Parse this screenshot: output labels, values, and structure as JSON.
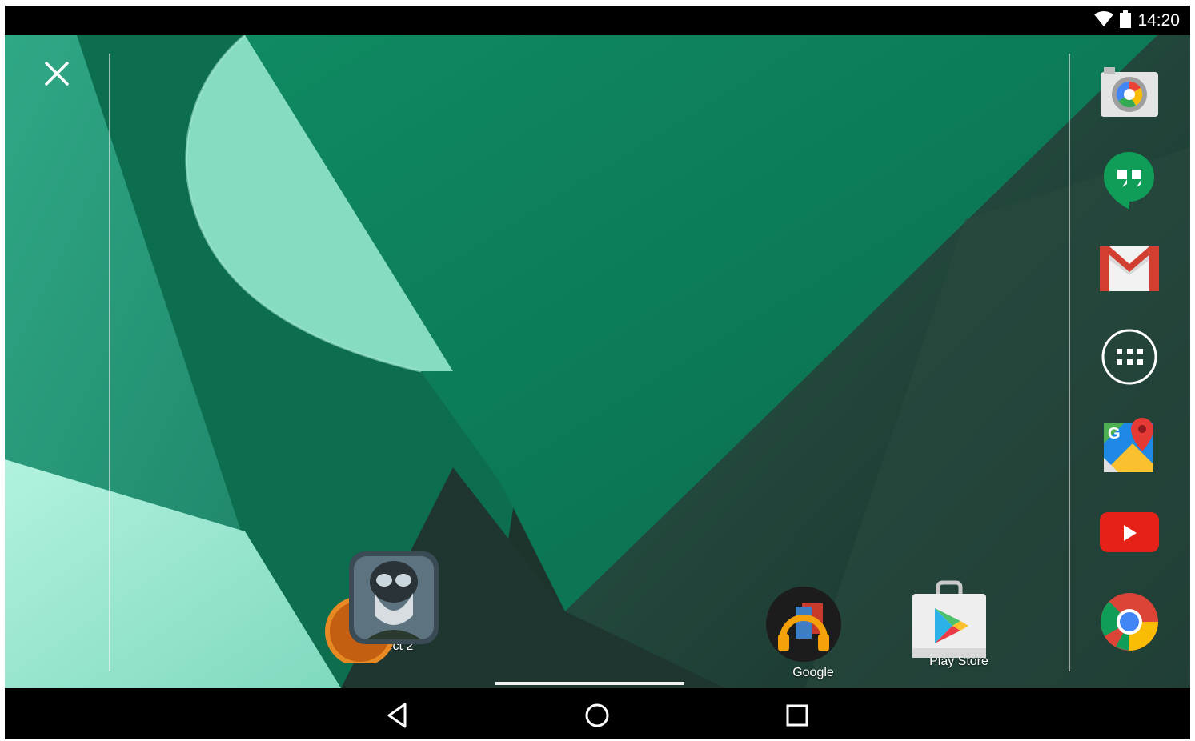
{
  "status_bar": {
    "time": "14:20",
    "icons": [
      "wifi-icon",
      "battery-icon"
    ]
  },
  "overlay": {
    "close_icon": "close-icon"
  },
  "home_apps": [
    {
      "label": "Dead Effect 2",
      "icon": "dead-effect-2-folder-icon"
    },
    {
      "label": "Google",
      "icon": "google-play-music-folder-icon"
    },
    {
      "label": "Play Store",
      "icon": "play-store-icon"
    }
  ],
  "dock": [
    {
      "name": "camera",
      "icon": "camera-icon"
    },
    {
      "name": "hangouts",
      "icon": "hangouts-icon"
    },
    {
      "name": "gmail",
      "icon": "gmail-icon"
    },
    {
      "name": "all-apps",
      "icon": "app-drawer-icon"
    },
    {
      "name": "maps",
      "icon": "maps-icon"
    },
    {
      "name": "youtube",
      "icon": "youtube-icon"
    },
    {
      "name": "chrome",
      "icon": "chrome-icon"
    }
  ],
  "nav_bar": {
    "buttons": [
      "back-icon",
      "home-icon",
      "recents-icon"
    ]
  },
  "colors": {
    "wallpaper_green": "#0e7a58",
    "wallpaper_dark": "#223a33",
    "wallpaper_mint": "#8fe6cd",
    "status_bar": "#000000"
  }
}
